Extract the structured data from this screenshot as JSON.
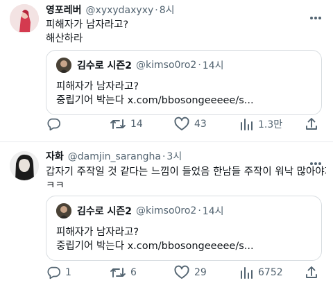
{
  "tweets": [
    {
      "name": "영포레버",
      "handle": "@xyxydaxyxy",
      "dot": "·",
      "time": "8시",
      "lines": [
        "피해자가 남자라고?",
        "해산하라"
      ],
      "quote": {
        "name": "김수로 시즌2",
        "handle": "@kimso0ro2",
        "dot": "·",
        "time": "14시",
        "lines": [
          "피해자가 남자라고?",
          "중립기어 박는다 x.com/bbosongeeeee/s..."
        ]
      },
      "actions": {
        "reply": "",
        "retweet": "14",
        "like": "43",
        "views": "1.3만"
      }
    },
    {
      "name": "자화",
      "handle": "@damjin_sarangha",
      "dot": "·",
      "time": "3시",
      "lines": [
        "갑자기 주작일 것 같다는 느낌이 들었음 한남들 주작이 워낙 많아야지",
        "ㅋㅋ"
      ],
      "quote": {
        "name": "김수로 시즌2",
        "handle": "@kimso0ro2",
        "dot": "·",
        "time": "14시",
        "lines": [
          "피해자가 남자라고?",
          "중립기어 박는다 x.com/bbosongeeeee/s..."
        ]
      },
      "actions": {
        "reply": "1",
        "retweet": "6",
        "like": "29",
        "views": "6752"
      }
    }
  ],
  "icons": {
    "reply": "reply-icon",
    "retweet": "retweet-icon",
    "like": "heart-icon",
    "views": "views-icon",
    "share": "share-icon",
    "more": "more-icon"
  },
  "colors": {
    "text": "#0f1419",
    "secondary": "#536471",
    "border": "#d8dde1"
  }
}
